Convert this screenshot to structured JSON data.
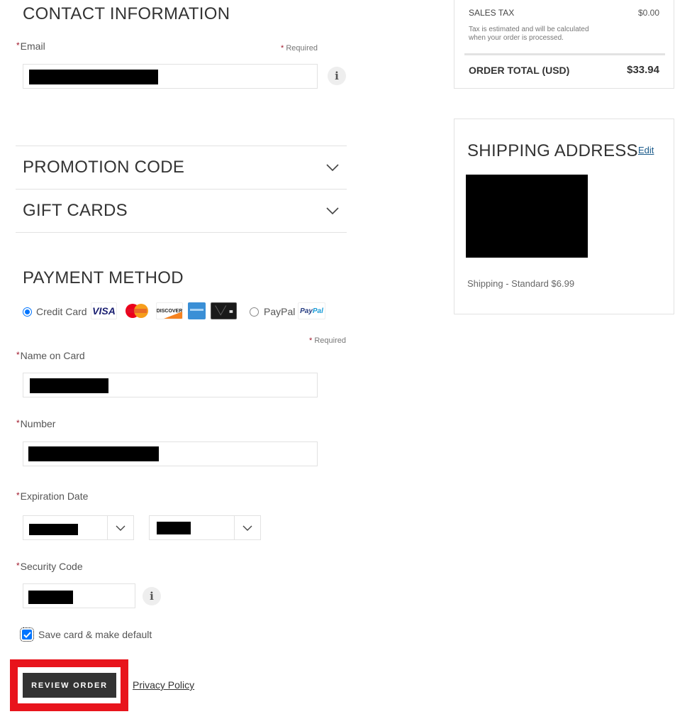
{
  "contact": {
    "title": "CONTACT INFORMATION",
    "email_label": "Email",
    "required_note": "Required",
    "email_value": "[redacted]",
    "info_icon": "info-icon"
  },
  "accordions": [
    {
      "label": "PROMOTION CODE",
      "icon": "chevron-down-icon"
    },
    {
      "label": "GIFT CARDS",
      "icon": "chevron-down-icon"
    }
  ],
  "payment": {
    "title": "PAYMENT METHOD",
    "options": [
      {
        "label": "Credit Card",
        "selected": true
      },
      {
        "label": "PayPal",
        "selected": false
      }
    ],
    "card_logos": [
      "VISA",
      "MasterCard",
      "DISCOVER",
      "American Express",
      "Black Card"
    ],
    "paypal_logo_a": "Pay",
    "paypal_logo_b": "Pal",
    "required_note": "Required",
    "name_label": "Name on Card",
    "name_value": "[redacted]",
    "number_label": "Number",
    "number_value": "[redacted]",
    "expiration_label": "Expiration Date",
    "exp_month_value": "[redacted]",
    "exp_year_value": "[redacted]",
    "security_label": "Security Code",
    "security_value": "[redacted]",
    "save_card_label": "Save card & make default",
    "save_card_checked": true,
    "review_button": "REVIEW ORDER",
    "privacy_link": "Privacy Policy"
  },
  "order_summary": {
    "sales_tax_label": "SALES TAX",
    "sales_tax_value": "$0.00",
    "tax_note_line1": "Tax is estimated and will be calculated",
    "tax_note_line2": "when your order is processed.",
    "total_label": "ORDER TOTAL (USD)",
    "total_value": "$33.94"
  },
  "shipping": {
    "title": "SHIPPING ADDRESS",
    "edit_link": "Edit",
    "address": "[redacted]",
    "method": "Shipping - Standard $6.99"
  },
  "colors": {
    "required_star": "#a0182b",
    "button_bg": "#333333",
    "radio_checkbox": "#0075ff",
    "highlight_box": "#e8141c",
    "link_blue": "#1a5a8a"
  }
}
